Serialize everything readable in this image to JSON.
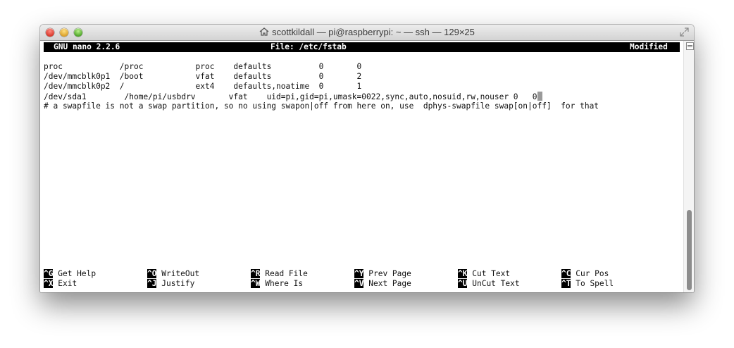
{
  "window": {
    "title": "scottkildall — pi@raspberrypi: ~ — ssh — 129×25"
  },
  "nano": {
    "version": "GNU nano 2.2.6",
    "file": "File: /etc/fstab",
    "status": "Modified"
  },
  "fstab_lines": [
    "proc            /proc           proc    defaults          0       0",
    "/dev/mmcblk0p1  /boot           vfat    defaults          0       2",
    "/dev/mmcblk0p2  /               ext4    defaults,noatime  0       1",
    "/dev/sda1        /home/pi/usbdrv       vfat    uid=pi,gid=pi,umask=0022,sync,auto,nosuid,rw,nouser 0   0",
    "# a swapfile is not a swap partition, so no using swapon|off from here on, use  dphys-swapfile swap[on|off]  for that"
  ],
  "shortcuts": [
    {
      "key": "^G",
      "label": "Get Help"
    },
    {
      "key": "^O",
      "label": "WriteOut"
    },
    {
      "key": "^R",
      "label": "Read File"
    },
    {
      "key": "^Y",
      "label": "Prev Page"
    },
    {
      "key": "^K",
      "label": "Cut Text"
    },
    {
      "key": "^C",
      "label": "Cur Pos"
    },
    {
      "key": "^X",
      "label": "Exit"
    },
    {
      "key": "^J",
      "label": "Justify"
    },
    {
      "key": "^W",
      "label": "Where Is"
    },
    {
      "key": "^V",
      "label": "Next Page"
    },
    {
      "key": "^U",
      "label": "UnCut Text"
    },
    {
      "key": "^T",
      "label": "To Spell"
    }
  ],
  "icons": {
    "home": "home-icon",
    "fullscreen": "fullscreen-icon",
    "scroll_button": "scroll-lines-icon"
  },
  "colors": {
    "close": "#ff5f57",
    "minimize": "#ffbd2e",
    "zoom": "#28c940"
  }
}
